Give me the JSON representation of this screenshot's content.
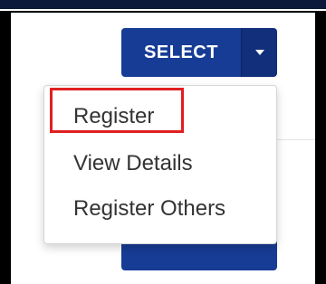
{
  "select_button": {
    "label": "SELECT"
  },
  "dropdown": {
    "items": [
      {
        "label": "Register",
        "highlighted": true
      },
      {
        "label": "View Details"
      },
      {
        "label": "Register Others"
      }
    ]
  },
  "colors": {
    "primary": "#173c95",
    "caret_bg": "#112f7a",
    "highlight": "#e02020",
    "text": "#333333"
  }
}
